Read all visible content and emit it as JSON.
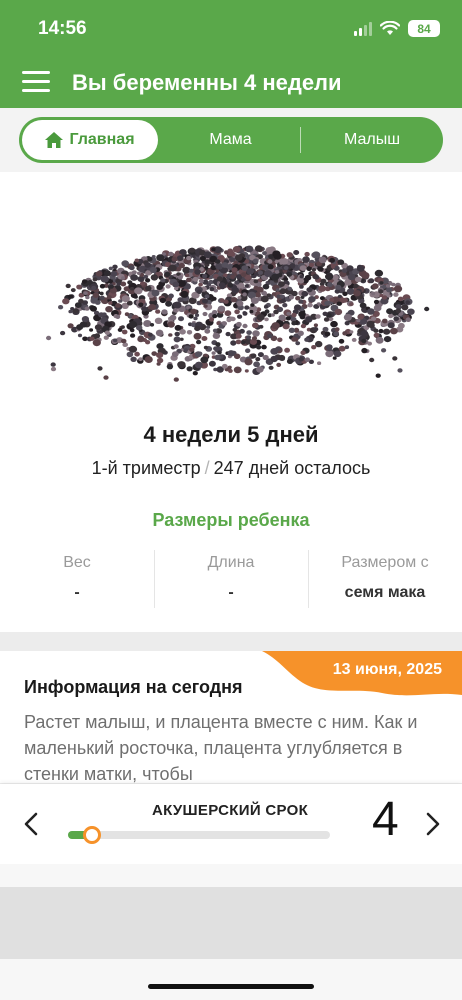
{
  "status_bar": {
    "time": "14:56",
    "battery": "84",
    "icons": [
      "signal-icon",
      "wifi-icon",
      "battery-icon"
    ]
  },
  "app_bar": {
    "title": "Вы беременны 4 недели",
    "menu_icon": "menu-icon"
  },
  "tabs": [
    {
      "label": "Главная",
      "icon": "home-icon",
      "active": true
    },
    {
      "label": "Мама",
      "active": false
    },
    {
      "label": "Малыш",
      "active": false
    }
  ],
  "week_info": {
    "title": "4 недели 5 дней",
    "trimester": "1-й триместр",
    "separator": "/",
    "days_left": "247 дней осталось"
  },
  "sizes": {
    "heading": "Размеры ребенка",
    "items": [
      {
        "label": "Вес",
        "value": "-"
      },
      {
        "label": "Длина",
        "value": "-"
      },
      {
        "label": "Размером с",
        "value": "семя мака"
      }
    ]
  },
  "info": {
    "date": "13 июня, 2025",
    "title": "Информация на сегодня",
    "text": "Растет малыш, и плацента вместе с ним. Как и маленький росточка, плацента углубляется в стенки матки, чтобы"
  },
  "term": {
    "label": "АКУШЕРСКИЙ СРОК",
    "week": "4",
    "progress": 0.09
  },
  "colors": {
    "primary": "#5aa84a",
    "accent": "#f6922a"
  }
}
